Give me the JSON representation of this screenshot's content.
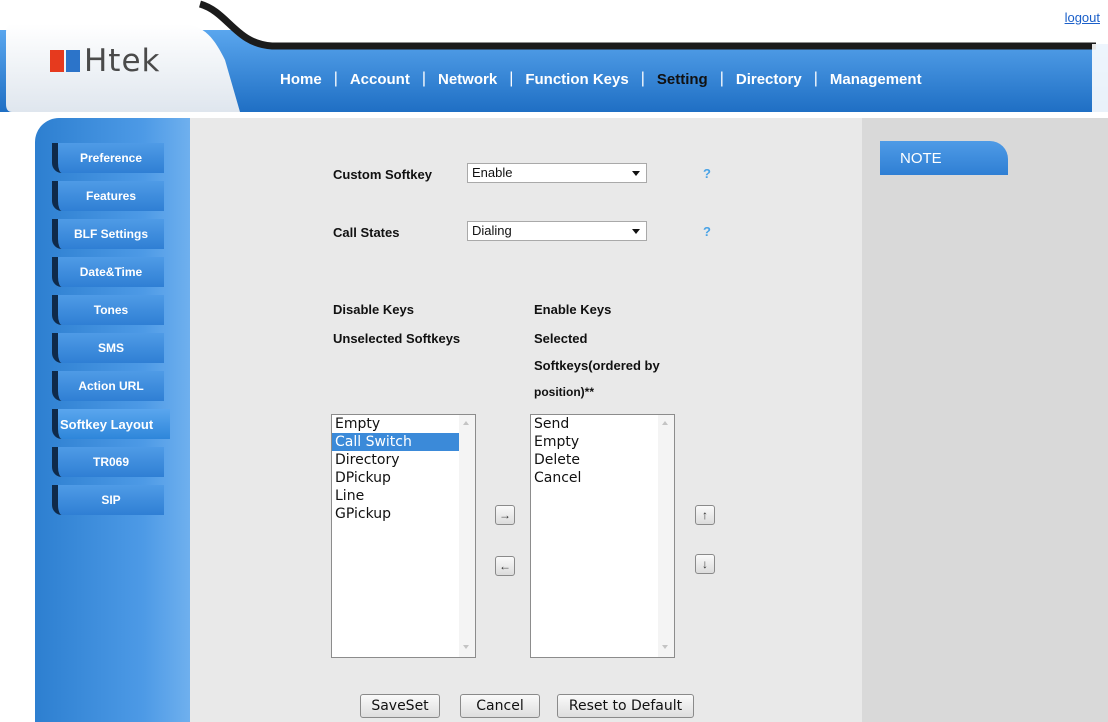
{
  "header": {
    "logout_label": "logout",
    "logo_text": "Htek",
    "nav": [
      {
        "label": "Home"
      },
      {
        "label": "Account"
      },
      {
        "label": "Network"
      },
      {
        "label": "Function Keys"
      },
      {
        "label": "Setting",
        "active": true
      },
      {
        "label": "Directory"
      },
      {
        "label": "Management"
      }
    ]
  },
  "sidebar": {
    "items": [
      {
        "label": "Preference"
      },
      {
        "label": "Features"
      },
      {
        "label": "BLF Settings"
      },
      {
        "label": "Date&Time"
      },
      {
        "label": "Tones"
      },
      {
        "label": "SMS"
      },
      {
        "label": "Action URL"
      },
      {
        "label": "Softkey Layout",
        "active": true
      },
      {
        "label": "TR069"
      },
      {
        "label": "SIP"
      }
    ]
  },
  "form": {
    "custom_softkey_label": "Custom Softkey",
    "custom_softkey_value": "Enable",
    "call_states_label": "Call States",
    "call_states_value": "Dialing",
    "help_symbol": "?",
    "disable_keys_label": "Disable Keys",
    "unselected_label": "Unselected Softkeys",
    "enable_keys_label": "Enable Keys",
    "selected_label_1": "Selected",
    "selected_label_2": "Softkeys(ordered by",
    "selected_label_3": "position)**",
    "unselected_options": [
      "Empty",
      "Call Switch",
      "Directory",
      "DPickup",
      "Line",
      "GPickup"
    ],
    "unselected_selected_index": 1,
    "selected_options": [
      "Send",
      "Empty",
      "Delete",
      "Cancel"
    ],
    "move_right_symbol": "→",
    "move_left_symbol": "←",
    "move_up_symbol": "↑",
    "move_down_symbol": "↓"
  },
  "buttons": {
    "save": "SaveSet",
    "cancel": "Cancel",
    "reset": "Reset to Default"
  },
  "note": {
    "title": "NOTE"
  },
  "colors": {
    "header_blue": "#2d80d6",
    "sidebar_blue": "#3d8ddc",
    "selection": "#3b8ad9"
  }
}
